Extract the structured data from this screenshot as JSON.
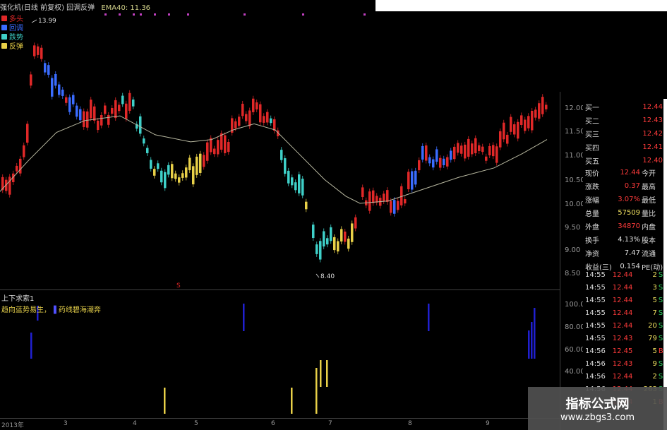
{
  "header": {
    "title": "强化机(日线 前复权) 回调反弹",
    "ema_label": "EMA40: 11.36"
  },
  "legend": [
    {
      "label": "多头",
      "color": "#e02828"
    },
    {
      "label": "回调",
      "color": "#3a6cff"
    },
    {
      "label": "跌势",
      "color": "#3fd0c8"
    },
    {
      "label": "反弹",
      "color": "#e8d048"
    }
  ],
  "annotations": {
    "high": "13.99",
    "low": "8.40",
    "marker": "S"
  },
  "price_axis": [
    "12.00",
    "11.50",
    "11.00",
    "10.50",
    "10.00",
    "9.50",
    "9.00",
    "8.50"
  ],
  "indicator_axis": [
    "100.00",
    "80.00",
    "60.00",
    "40.00"
  ],
  "indicator": {
    "title": "上下求索1",
    "desc": "趋向蓝势易生，",
    "desc2": "药线碧海潮奔"
  },
  "time_axis": [
    "2013年",
    "3",
    "4",
    "5",
    "6",
    "7",
    "8",
    "9"
  ],
  "order_book": [
    {
      "label": "买一",
      "price": "12.44"
    },
    {
      "label": "买二",
      "price": "12.43"
    },
    {
      "label": "买三",
      "price": "12.42"
    },
    {
      "label": "买四",
      "price": "12.41"
    },
    {
      "label": "买五",
      "price": "12.40"
    }
  ],
  "quote": [
    {
      "label": "现价",
      "value": "12.44",
      "label2": "今开",
      "color": "#ff3b3b"
    },
    {
      "label": "涨跌",
      "value": "0.37",
      "label2": "最高",
      "color": "#ff3b3b"
    },
    {
      "label": "涨幅",
      "value": "3.07%",
      "label2": "最低",
      "color": "#ff3b3b"
    },
    {
      "label": "总量",
      "value": "57509",
      "label2": "量比",
      "color": "#f0e060"
    },
    {
      "label": "外盘",
      "value": "34870",
      "label2": "内盘",
      "color": "#ff3b3b"
    },
    {
      "label": "换手",
      "value": "4.13%",
      "label2": "股本",
      "color": "#e0e0e0"
    },
    {
      "label": "净资",
      "value": "7.47",
      "label2": "流通",
      "color": "#e0e0e0"
    },
    {
      "label": "收益(三)",
      "value": "0.154",
      "label2": "PE(动)",
      "color": "#e0e0e0"
    }
  ],
  "ticks": [
    {
      "time": "14:55",
      "price": "12.44",
      "vol": "2",
      "side": "S"
    },
    {
      "time": "14:55",
      "price": "12.44",
      "vol": "3",
      "side": "S"
    },
    {
      "time": "14:55",
      "price": "12.44",
      "vol": "5",
      "side": "S"
    },
    {
      "time": "14:55",
      "price": "12.44",
      "vol": "7",
      "side": "S"
    },
    {
      "time": "14:55",
      "price": "12.44",
      "vol": "20",
      "side": "S"
    },
    {
      "time": "14:55",
      "price": "12.43",
      "vol": "79",
      "side": "S"
    },
    {
      "time": "14:56",
      "price": "12.45",
      "vol": "5",
      "side": "B"
    },
    {
      "time": "14:56",
      "price": "12.43",
      "vol": "9",
      "side": "S"
    },
    {
      "time": "14:56",
      "price": "12.44",
      "vol": "2",
      "side": "S"
    },
    {
      "time": "14:56",
      "price": "12.44",
      "vol": "263",
      "side": "S"
    },
    {
      "time": "14:56",
      "price": "12.44",
      "vol": "1",
      "side": "B"
    }
  ],
  "watermark": {
    "line1": "指标公式网",
    "line2": "www.zbgs3.com"
  },
  "colors": {
    "up": "#e02828",
    "pullback": "#3a6cff",
    "down": "#3fd0c8",
    "rebound": "#e8d048",
    "ema": "#c8c8a8"
  }
}
